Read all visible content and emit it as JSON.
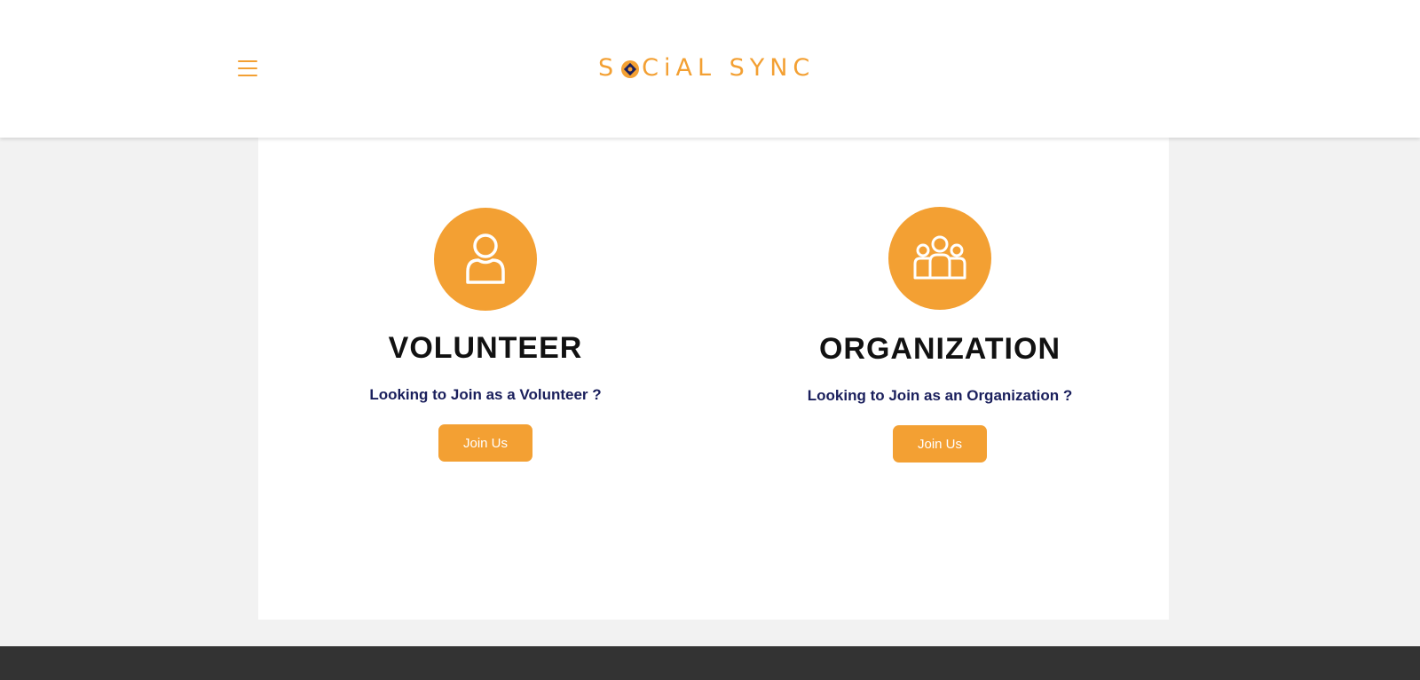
{
  "header": {
    "menu_icon": "hamburger-menu-icon",
    "logo": {
      "text_before": "S",
      "text_after": "CiAL SYNC",
      "mark_icon": "logo-mark-icon",
      "colors": {
        "accent": "#f3a033",
        "dark": "#1a1f5c"
      }
    }
  },
  "roles": [
    {
      "icon": "person-icon",
      "title": "VOLUNTEER",
      "subtitle": "Looking to Join as a Volunteer ?",
      "button_label": "Join Us"
    },
    {
      "icon": "group-icon",
      "title": "ORGANIZATION",
      "subtitle": "Looking to Join as an Organization ?",
      "button_label": "Join Us"
    }
  ],
  "colors": {
    "accent": "#f3a033",
    "page_background": "#f2f2f2",
    "card_background": "#ffffff",
    "title_text": "#111111",
    "subtitle_text": "#1a1f5c",
    "footer_background": "#333333"
  }
}
